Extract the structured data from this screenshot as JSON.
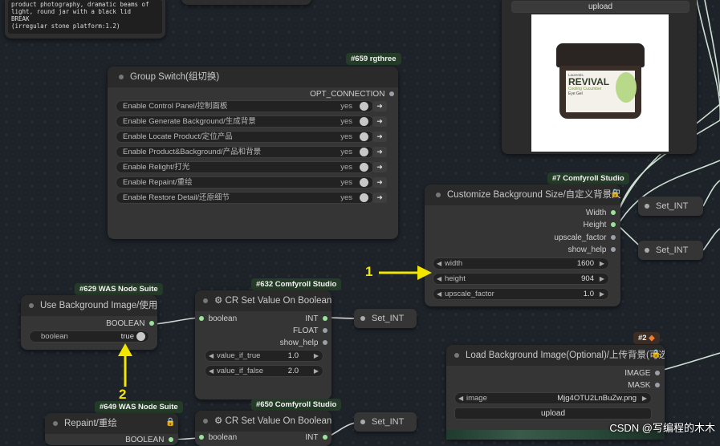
{
  "prompt_node": {
    "text_lines": [
      "product photography, dramatic beams of",
      "light, round jar with a black lid",
      "BREAK",
      "(irregular stone platform:1.2)"
    ]
  },
  "upload_node": {
    "upload_label": "upload",
    "product": {
      "brand": "Laurentis.",
      "name": "REVIVAL",
      "line1": "Cooling Cucumber",
      "line2": "Eye Gel"
    }
  },
  "group_switch": {
    "badge": "#659 rgthree",
    "title": "Group Switch(组切换)",
    "output": "OPT_CONNECTION",
    "items": [
      {
        "label": "Enable Control Panel/控制面板",
        "state": "yes"
      },
      {
        "label": "Enable Generate Background/生成背景",
        "state": "yes"
      },
      {
        "label": "Enable Locate Product/定位产品",
        "state": "yes"
      },
      {
        "label": "Enable Product&Background/产品和背景",
        "state": "yes"
      },
      {
        "label": "Enable Relight/打光",
        "state": "yes"
      },
      {
        "label": "Enable Repaint/重绘",
        "state": "yes"
      },
      {
        "label": "Enable Restore Detail/还原细节",
        "state": "yes"
      }
    ]
  },
  "bg_size": {
    "badge": "#7 Comfyroll Studio",
    "title": "Customize Background Size/自定义背景尺寸",
    "outputs": [
      "Width",
      "Height",
      "upscale_factor",
      "show_help"
    ],
    "widgets": [
      {
        "label": "width",
        "value": "1600"
      },
      {
        "label": "height",
        "value": "904"
      },
      {
        "label": "upscale_factor",
        "value": "1.0"
      }
    ]
  },
  "set_int": {
    "label": "Set_INT"
  },
  "use_bg": {
    "badge": "#629 WAS Node Suite",
    "title": "Use Background Image/使用背景图",
    "output": "BOOLEAN",
    "widget_label": "boolean",
    "widget_value": "true"
  },
  "cr_set_632": {
    "badge": "#632 Comfyroll Studio",
    "title": "CR Set Value On Boolean",
    "input": "boolean",
    "outputs": [
      "INT",
      "FLOAT",
      "show_help"
    ],
    "widgets": [
      {
        "label": "value_if_true",
        "value": "1.0"
      },
      {
        "label": "value_if_false",
        "value": "2.0"
      }
    ]
  },
  "load_bg": {
    "badge": "#2",
    "title": "Load Background Image(Optional)/上传背景(可选)",
    "outputs": [
      "IMAGE",
      "MASK"
    ],
    "image_label": "image",
    "image_value": "Mjg4OTU2LnBuZw.png",
    "upload_label": "upload"
  },
  "repaint": {
    "badge": "#649 WAS Node Suite",
    "title": "Repaint/重绘",
    "output": "BOOLEAN"
  },
  "cr_set_650": {
    "badge": "#650 Comfyroll Studio",
    "title": "CR Set Value On Boolean",
    "input": "boolean",
    "output": "INT"
  },
  "annotations": {
    "a1": "1",
    "a2": "2"
  },
  "watermark": "CSDN @写编程的木木",
  "colors": {
    "canvas": "#1d2329",
    "node": "#353535",
    "annotation": "#f2e600",
    "wire": "#c8ddd0"
  }
}
